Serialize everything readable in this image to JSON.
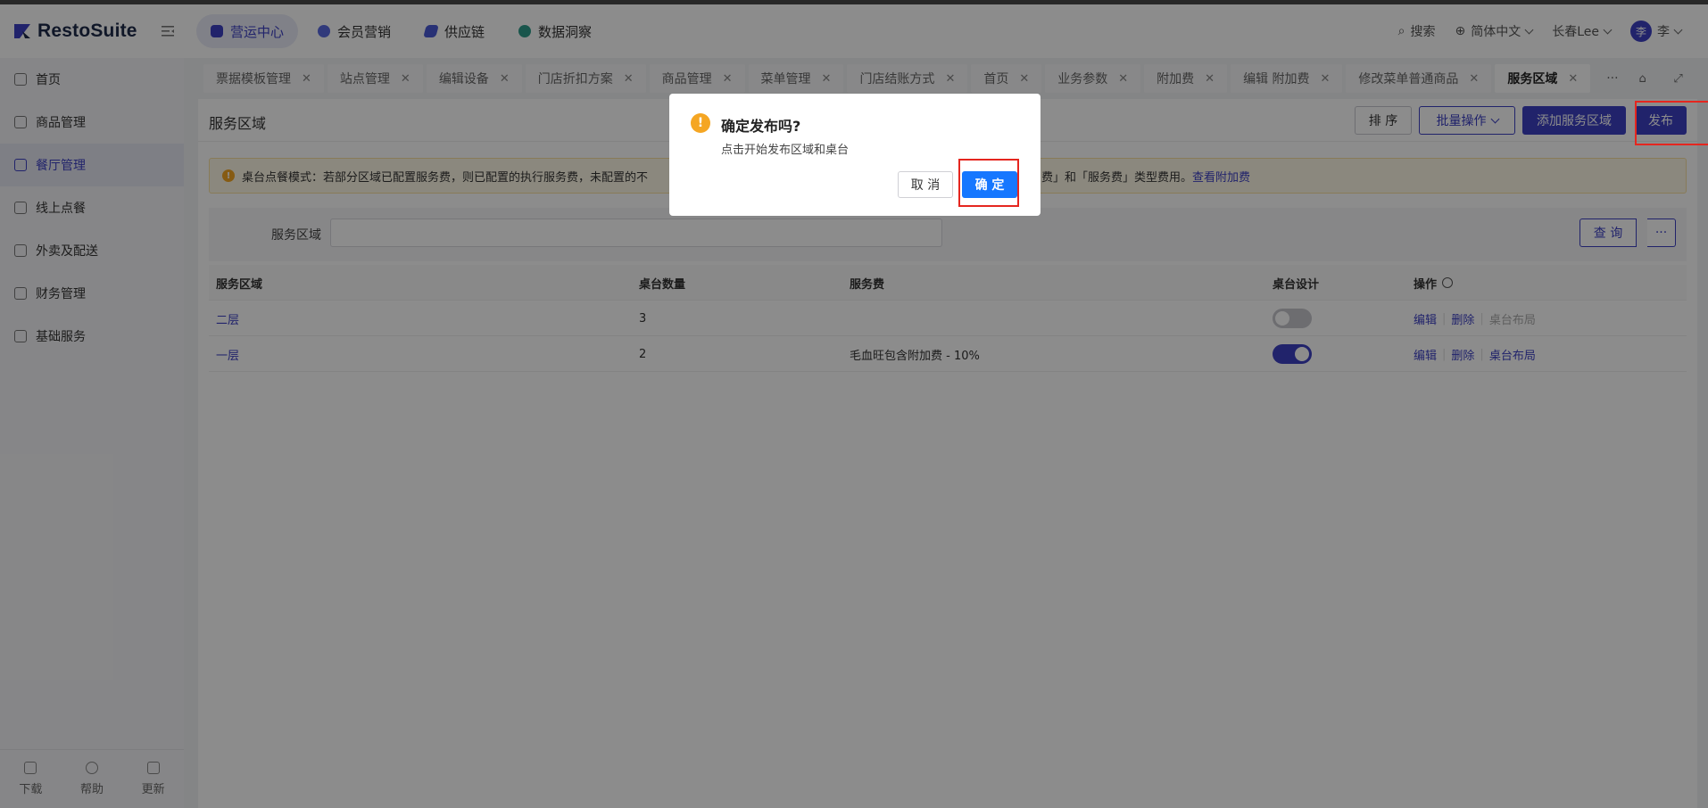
{
  "brand": "RestoSuite",
  "nav": [
    {
      "label": "营运中心",
      "active": true,
      "color": "#3d40c4"
    },
    {
      "label": "会员营销",
      "active": false,
      "color": "#5a6be0"
    },
    {
      "label": "供应链",
      "active": false,
      "color": "#4a5ad6"
    },
    {
      "label": "数据洞察",
      "active": false,
      "color": "#2f9c8a"
    }
  ],
  "header_right": {
    "search": "搜索",
    "language": "简体中文",
    "store": "长春Lee",
    "avatar_initial": "李",
    "user": "李"
  },
  "sidebar": {
    "items": [
      {
        "label": "首页"
      },
      {
        "label": "商品管理"
      },
      {
        "label": "餐厅管理",
        "active": true
      },
      {
        "label": "线上点餐"
      },
      {
        "label": "外卖及配送"
      },
      {
        "label": "财务管理"
      },
      {
        "label": "基础服务"
      }
    ],
    "bottom": [
      {
        "label": "下载"
      },
      {
        "label": "帮助"
      },
      {
        "label": "更新"
      }
    ]
  },
  "tabs": [
    {
      "label": "票据模板管理"
    },
    {
      "label": "站点管理"
    },
    {
      "label": "编辑设备"
    },
    {
      "label": "门店折扣方案"
    },
    {
      "label": "商品管理"
    },
    {
      "label": "菜单管理"
    },
    {
      "label": "门店结账方式"
    },
    {
      "label": "首页"
    },
    {
      "label": "业务参数"
    },
    {
      "label": "附加费"
    },
    {
      "label": "编辑 附加费"
    },
    {
      "label": "修改菜单普通商品"
    },
    {
      "label": "服务区域",
      "active": true
    }
  ],
  "tabs_more": "···",
  "page": {
    "title": "服务区域",
    "buttons": {
      "sort": "排 序",
      "batch": "批量操作",
      "add": "添加服务区域",
      "publish": "发布"
    },
    "alert": {
      "text": "桌台点餐模式：若部分区域已配置服务费，则已配置的执行服务费，未配置的不",
      "text2": "加费」和「服务费」类型费用。",
      "link": "查看附加费"
    },
    "filter": {
      "label": "服务区域",
      "query": "查 询",
      "more": "···"
    },
    "table": {
      "headers": [
        "服务区域",
        "桌台数量",
        "服务费",
        "桌台设计",
        "操作"
      ],
      "rows": [
        {
          "area": "二层",
          "count": "3",
          "fee": "",
          "design_on": false,
          "edit": "编辑",
          "delete": "删除",
          "layout": "桌台布局",
          "layout_enabled": false
        },
        {
          "area": "一层",
          "count": "2",
          "fee": "毛血旺包含附加费 - 10%",
          "design_on": true,
          "edit": "编辑",
          "delete": "删除",
          "layout": "桌台布局",
          "layout_enabled": true
        }
      ]
    }
  },
  "dialog": {
    "title": "确定发布吗?",
    "body": "点击开始发布区域和桌台",
    "cancel": "取 消",
    "ok": "确 定"
  }
}
